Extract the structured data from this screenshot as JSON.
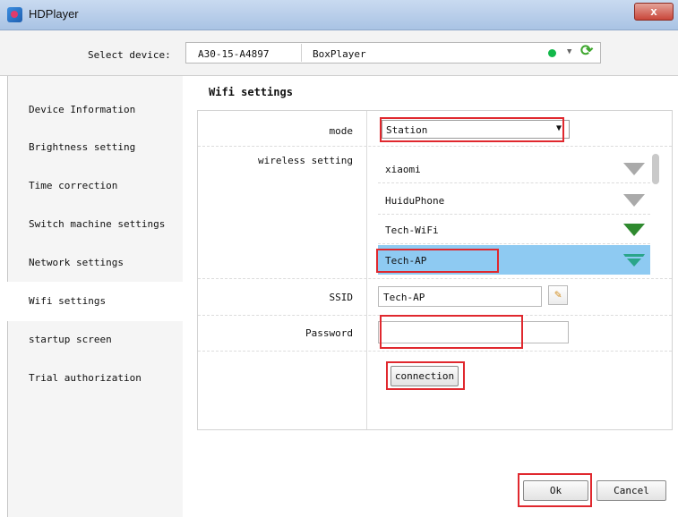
{
  "window": {
    "title": "HDPlayer",
    "close_label": "x"
  },
  "device_bar": {
    "select_label": "Select device:",
    "device_id": "A30-15-A4897",
    "device_name": "BoxPlayer",
    "status_color": "#12b84a"
  },
  "sidebar": {
    "items": [
      {
        "label": "Device Information"
      },
      {
        "label": "Brightness setting"
      },
      {
        "label": "Time correction"
      },
      {
        "label": "Switch machine settings"
      },
      {
        "label": "Network settings"
      },
      {
        "label": "Wifi settings",
        "active": true
      },
      {
        "label": "startup screen"
      },
      {
        "label": "Trial authorization"
      }
    ]
  },
  "wifi": {
    "title": "Wifi settings",
    "mode_label": "mode",
    "mode_value": "Station",
    "wireless_label": "wireless setting",
    "networks": [
      {
        "name": "xiaomi",
        "signal_color": "#aaaaaa"
      },
      {
        "name": "HuiduPhone",
        "signal_color": "#aaaaaa"
      },
      {
        "name": "Tech-WiFi",
        "signal_color": "#2f8a2f"
      },
      {
        "name": "Tech-AP",
        "signal_color": "#2aa58a",
        "selected": true
      }
    ],
    "ssid_label": "SSID",
    "ssid_value": "Tech-AP",
    "password_label": "Password",
    "password_value": "",
    "connect_label": "connection"
  },
  "footer": {
    "ok_label": "Ok",
    "cancel_label": "Cancel"
  },
  "highlight_color": "#e0282e"
}
